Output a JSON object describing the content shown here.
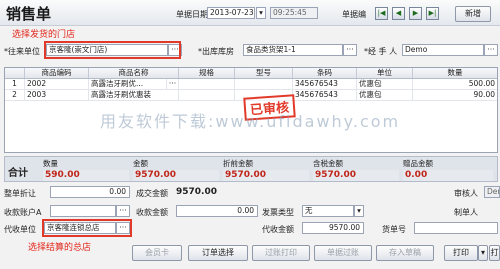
{
  "window": {
    "title": "销售单"
  },
  "header": {
    "date_label": "单据日期",
    "date_value": "2013-07-23",
    "time_value": "09:25:45",
    "billno_label": "单据编",
    "nav_buttons": [
      "|◀",
      "◀",
      "▶",
      "▶|"
    ],
    "new_label": "新增"
  },
  "form": {
    "customer_label": "*往来单位",
    "customer_value": "京客隆(崇文门店)",
    "warehouse_label": "*出库库房",
    "warehouse_value": "食品类货架1-1",
    "handler_label": "*经 手 人",
    "handler_value": "Demo"
  },
  "annotations": {
    "store_hint": "选择发货的门店",
    "settle_hint": "选择结算的总店"
  },
  "grid": {
    "columns": [
      "",
      "商品编码",
      "商品名称",
      "规格",
      "型号",
      "条码",
      "单位",
      "数量"
    ],
    "rows": [
      {
        "no": "1",
        "code": "2002",
        "name": "高露洁牙刷优...",
        "spec": "",
        "model": "",
        "barcode": "345676543",
        "unit": "优惠包",
        "qty": "500.00"
      },
      {
        "no": "2",
        "code": "2003",
        "name": "高露洁牙刷优惠装",
        "spec": "",
        "model": "",
        "barcode": "345676543",
        "unit": "优惠包",
        "qty": "90.00"
      }
    ]
  },
  "watermark": "用友软件下载:www.ufidawhy.com",
  "stamp": "已审核",
  "totals": {
    "label": "合计",
    "qty_label": "数量",
    "qty_value": "590.00",
    "amount_label": "金额",
    "amount_value": "9570.00",
    "discount_amount_label": "折前金额",
    "discount_amount_value": "9570.00",
    "tax_amount_label": "含税金额",
    "tax_amount_value": "9570.00",
    "gift_amount_label": "赠品金额",
    "gift_amount_value": "0.00"
  },
  "footer": {
    "whole_discount_label": "整单折让",
    "whole_discount_value": "0.00",
    "deal_amount_label": "成交金额",
    "deal_amount_value": "9570.00",
    "auditor_label": "审核人",
    "auditor_value": "Dem",
    "receive_account_label": "收款账户A",
    "receive_amount_label": "收款金额",
    "receive_amount_value": "0.00",
    "invoice_type_label": "发票类型",
    "invoice_type_value": "无",
    "maker_label": "制单人",
    "proxy_label": "代收单位",
    "proxy_value": "京客隆连锁总店",
    "proxy_amount_label": "代收金额",
    "proxy_amount_value": "9570.00",
    "goods_no_label": "货单号"
  },
  "buttons": {
    "member_card": "会员卡",
    "order_select": "订单选择",
    "transfer_print": "过账打印",
    "bill_transfer": "单据过账",
    "save_draft": "存入草稿",
    "print": "打印",
    "print_more": "打"
  }
}
